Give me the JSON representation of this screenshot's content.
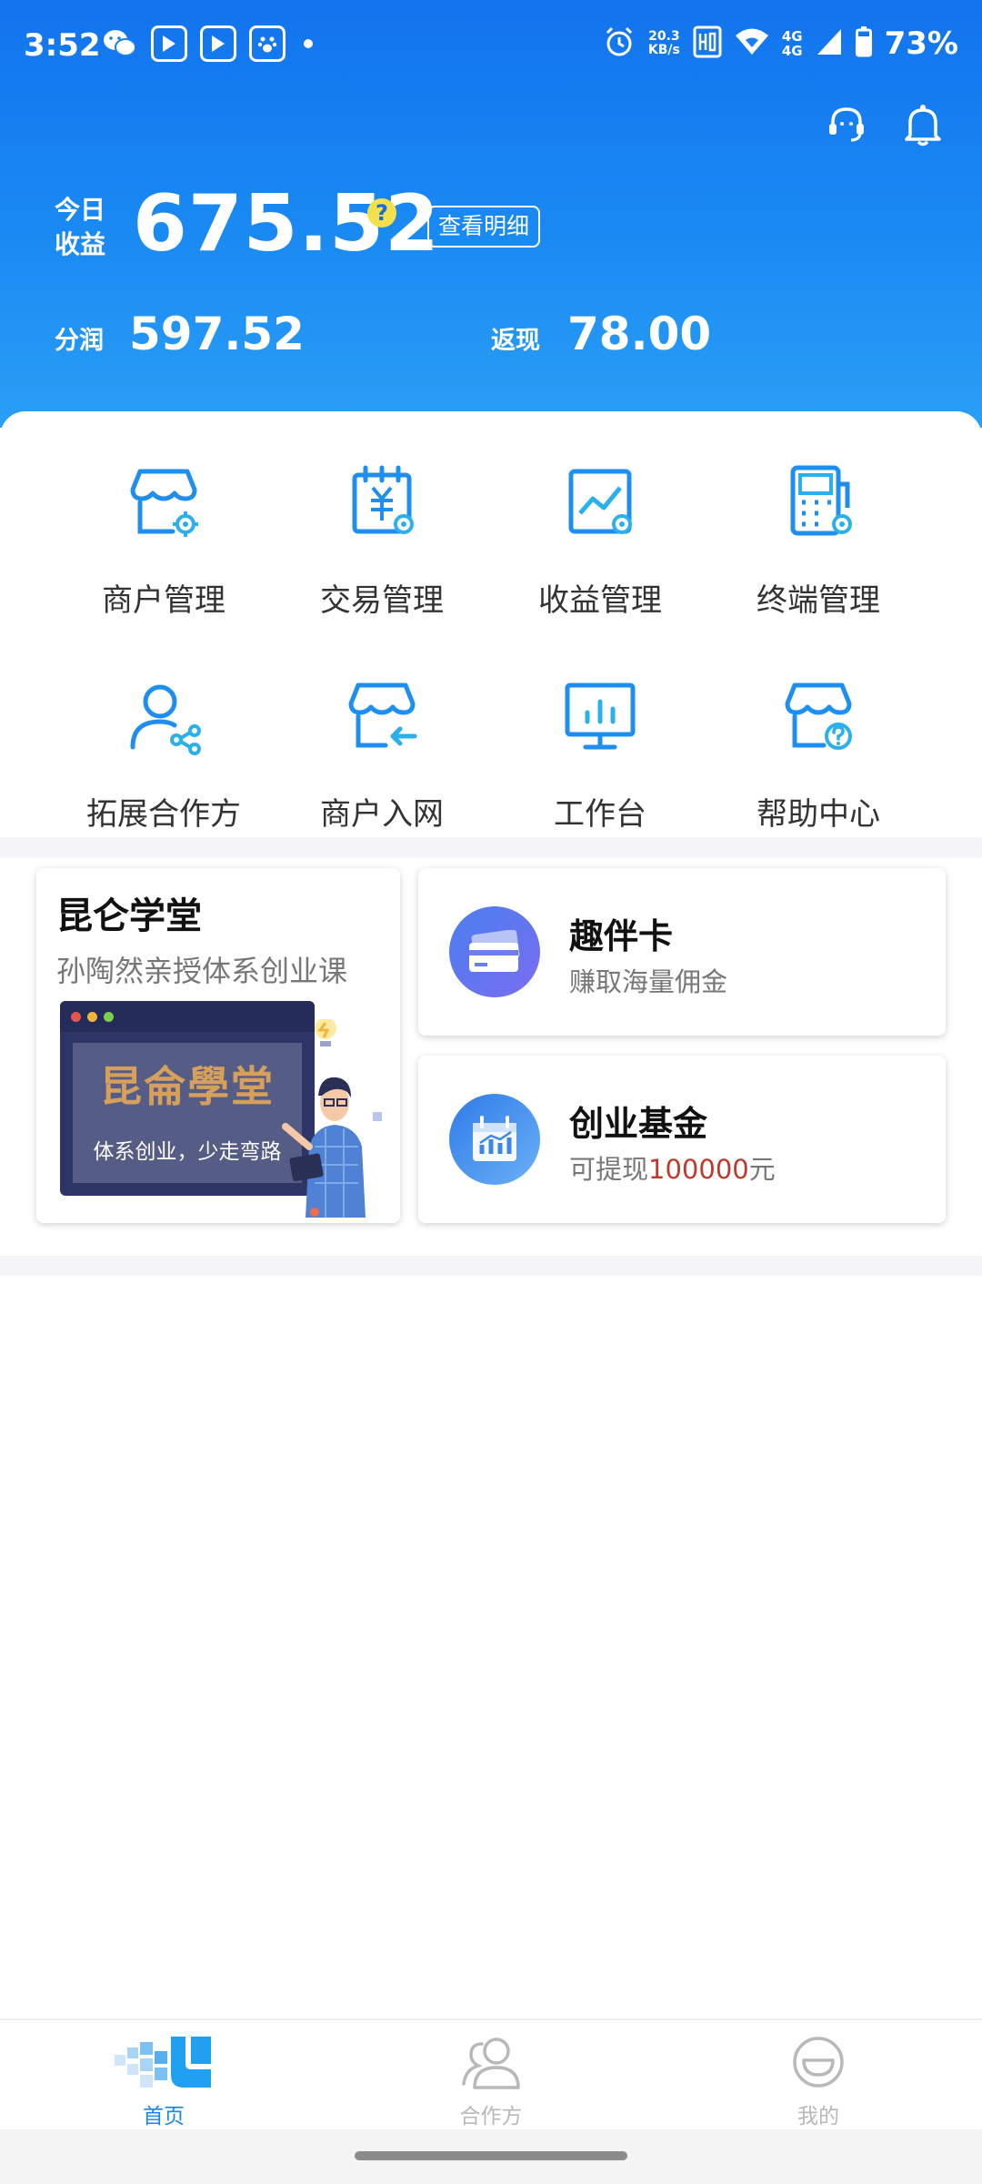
{
  "status_bar": {
    "time": "3:52",
    "net_speed_value": "20.3",
    "net_speed_unit": "KB/s",
    "network_top": "4G",
    "network_bottom": "4G",
    "battery": "73%"
  },
  "header": {
    "today_income_label_1": "今日",
    "today_income_label_2": "收益",
    "today_income_value": "675.52",
    "help_symbol": "?",
    "detail_button": "查看明细",
    "profit_label": "分润",
    "profit_value": "597.52",
    "cashback_label": "返现",
    "cashback_value": "78.00"
  },
  "menu": [
    {
      "label": "商户管理",
      "icon": "merchant-management-icon"
    },
    {
      "label": "交易管理",
      "icon": "transaction-management-icon"
    },
    {
      "label": "收益管理",
      "icon": "income-management-icon"
    },
    {
      "label": "终端管理",
      "icon": "terminal-management-icon"
    },
    {
      "label": "拓展合作方",
      "icon": "partner-expansion-icon"
    },
    {
      "label": "商户入网",
      "icon": "merchant-onboarding-icon"
    },
    {
      "label": "工作台",
      "icon": "workbench-icon"
    },
    {
      "label": "帮助中心",
      "icon": "help-center-icon"
    }
  ],
  "promo": {
    "kunlun": {
      "title": "昆仑学堂",
      "subtitle": "孙陶然亲授体系创业课",
      "board_text": "昆侖學堂",
      "board_slogan": "体系创业，少走弯路"
    },
    "card1": {
      "title": "趣伴卡",
      "subtitle": "赚取海量佣金"
    },
    "card2": {
      "title": "创业基金",
      "subtitle_prefix": "可提现",
      "subtitle_amount": "100000",
      "subtitle_suffix": "元"
    }
  },
  "bottom_nav": [
    {
      "label": "首页",
      "active": true
    },
    {
      "label": "合作方",
      "active": false
    },
    {
      "label": "我的",
      "active": false
    }
  ],
  "colors": {
    "primary": "#1a7ff0",
    "accent_blue": "#1fa0f0",
    "highlight_red": "#c0392b",
    "inactive": "#b8b8b8"
  }
}
